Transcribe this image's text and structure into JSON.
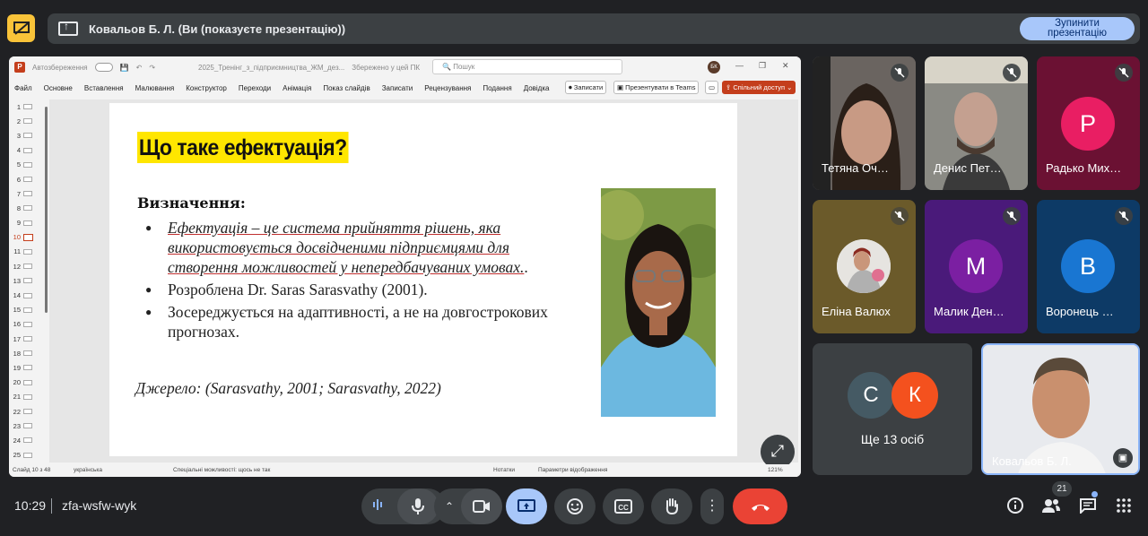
{
  "banner": {
    "title": "Ковальов Б. Л. (Ви (показуєте презентацію))",
    "stop_line1": "Зупинити",
    "stop_line2": "презентацію"
  },
  "ppt": {
    "autosave_label": "Автозбереження",
    "file_title": "2025_Тренінг_з_підприємництва_ЖМ_дез...",
    "saved_label": "Збережено у цей ПК",
    "search_placeholder": "Пошук",
    "avatar_initials": "БК",
    "menu": [
      "Файл",
      "Основне",
      "Вставлення",
      "Малювання",
      "Конструктор",
      "Переходи",
      "Анімація",
      "Показ слайдів",
      "Записати",
      "Рецензування",
      "Подання",
      "Довідка"
    ],
    "record_btn": "Записати",
    "present_teams_btn": "Презентувати в Teams",
    "share_btn": "Спільний доступ",
    "slide_numbers": [
      "1",
      "2",
      "3",
      "4",
      "5",
      "6",
      "7",
      "8",
      "9",
      "10",
      "11",
      "12",
      "13",
      "14",
      "15",
      "16",
      "17",
      "18",
      "19",
      "20",
      "21",
      "22",
      "23",
      "24",
      "25"
    ],
    "active_slide": 10,
    "status": {
      "slide_of": "Слайд 10 з 48",
      "language": "українська",
      "accessibility": "Спеціальні можливості: щось не так",
      "notes": "Нотатки",
      "display_settings": "Параметри відображення",
      "zoom": "121%"
    }
  },
  "slide": {
    "title": "Що таке ефектуація?",
    "definition_label": "Визначення:",
    "bullet1_italic": "Ефектуація – це система прийняття рішень, яка використовується досвідченими підприємцями для створення можливостей у непередбачуваних умовах.",
    "bullet1_tail": ".",
    "bullet2": "Розроблена Dr. Saras Sarasvathy (2001).",
    "bullet3": "Зосереджується на адаптивності, а не на довгострокових прогнозах.",
    "source": "Джерело: (Sarasvathy, 2001; Sarasvathy, 2022)"
  },
  "participants": [
    {
      "name": "Тетяна Оч…",
      "muted": true
    },
    {
      "name": "Денис Пет…",
      "muted": true
    },
    {
      "name": "Радько Мих…",
      "initial": "Р",
      "color": "#e91e63",
      "muted": true
    },
    {
      "name": "Еліна Валюх",
      "muted": true
    },
    {
      "name": "Малик Ден…",
      "initial": "М",
      "color": "#7b1fa2",
      "muted": true
    },
    {
      "name": "Воронець …",
      "initial": "В",
      "color": "#1976d2",
      "muted": true
    }
  ],
  "group_tile": {
    "label": "Ще 13 осіб",
    "initial_a": "С",
    "initial_b": "К"
  },
  "self_tile": {
    "name": "Ковальов Б. Л."
  },
  "bottom": {
    "time": "10:29",
    "meeting_code": "zfa-wsfw-wyk",
    "participant_count": "21"
  }
}
